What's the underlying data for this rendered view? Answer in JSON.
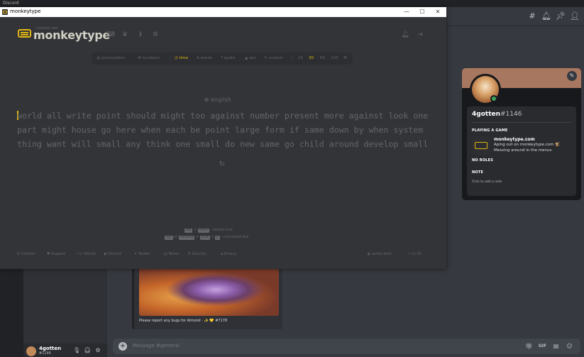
{
  "discord": {
    "titlebar": "Discord",
    "username": "4gotten",
    "usertag": "#1146",
    "message_placeholder": "Message #general",
    "embed_footer": "Please report any bugs for Atmoist · ✨ 💛 #7178",
    "profile": {
      "name": "4gotten",
      "tag": "#1146",
      "playing_title": "PLAYING A GAME",
      "game_title": "monkeytype.com",
      "game_state": "Aping out on monkeytype.com 🐒",
      "game_details": "Messing around in the menus",
      "roles_title": "NO ROLES",
      "note_title": "NOTE",
      "note_placeholder": "Click to add a note"
    },
    "colors": {
      "online": "#3ba55d",
      "banner": "#a87760"
    }
  },
  "monkeytype": {
    "window_title": "monkeytype",
    "logo_top": "monkey see",
    "logo_text": "monkeytype",
    "config": {
      "punctuation": "punctuation",
      "numbers": "numbers",
      "time": "time",
      "words": "words",
      "quote": "quote",
      "zen": "zen",
      "custom": "custom",
      "t15": "15",
      "t30": "30",
      "t60": "60",
      "t120": "120",
      "tool": "⚒"
    },
    "language": "english",
    "words_line1_first": "w",
    "words_line1_rest": "orld all write point should might too against number present more against look one",
    "words_line2": "part might house go here when each be point large form if same down by when system",
    "words_line3": "thing want will small any think one small do new same go child around develop small",
    "hints": {
      "tab": "tab",
      "plus1": "+",
      "enter": "enter",
      "restart": "- restart test",
      "esc": "esc",
      "or": "or",
      "ctrlshift": "ctrl/cmd",
      "plus2": "+",
      "shift": "shift",
      "plus3": "+",
      "p": "p",
      "command": "- command line"
    },
    "footer": {
      "contact": "Contact",
      "support": "Support",
      "github": "Github",
      "discord": "Discord",
      "twitter": "Twitter",
      "terms": "Terms",
      "security": "Security",
      "privacy": "Privacy",
      "theme": "serika dark",
      "version": "v1.10"
    },
    "colors": {
      "accent": "#e2b714",
      "bg": "#323437",
      "sub": "#646669",
      "text": "#d1d0c5"
    }
  }
}
